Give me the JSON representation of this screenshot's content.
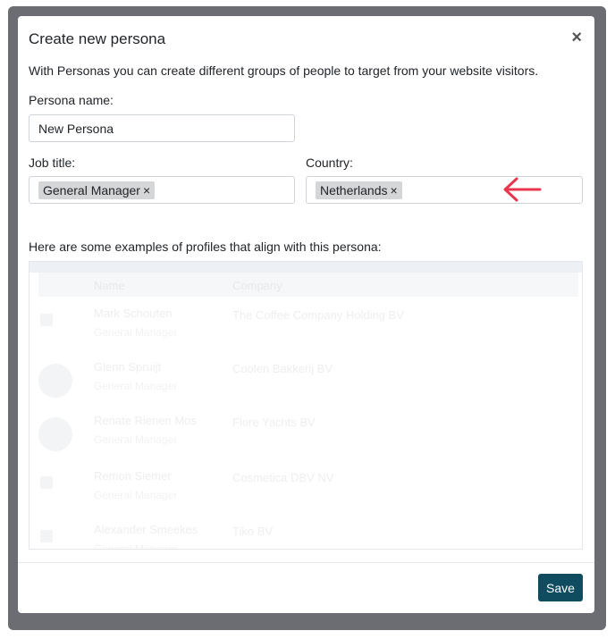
{
  "modal": {
    "title": "Create new persona",
    "close_symbol": "×",
    "description": "With Personas you can create different groups of people to target from your website visitors.",
    "persona_name": {
      "label": "Persona name:",
      "value": "New Persona"
    },
    "job_title": {
      "label": "Job title:",
      "tags": [
        "General Manager"
      ],
      "remove_symbol": "×"
    },
    "country": {
      "label": "Country:",
      "tags": [
        "Netherlands"
      ],
      "remove_symbol": "×"
    },
    "examples_title": "Here are some examples of profiles that align with this persona:",
    "profiles": {
      "columns": [
        "Name",
        "Company"
      ],
      "rows": [
        {
          "name": "Mark Schouten",
          "role": "General Manager",
          "company": "The Coffee Company Holding BV"
        },
        {
          "name": "Glenn Spruijt",
          "role": "General Manager",
          "company": "Coolen Bakkerij BV"
        },
        {
          "name": "Renate Rienen Mos",
          "role": "General Manager",
          "company": "Flore Yachts BV"
        },
        {
          "name": "Remon Siemer",
          "role": "General Manager",
          "company": "Cosmetica DBV NV"
        },
        {
          "name": "Alexander Smeekes",
          "role": "General Manager",
          "company": "Tiko BV"
        }
      ]
    },
    "save_label": "Save"
  },
  "annotation": {
    "arrow_color": "#e8364f",
    "icon": "left-arrow-icon"
  },
  "colors": {
    "primary": "#0f4c60",
    "backdrop": "#6b6d72"
  }
}
